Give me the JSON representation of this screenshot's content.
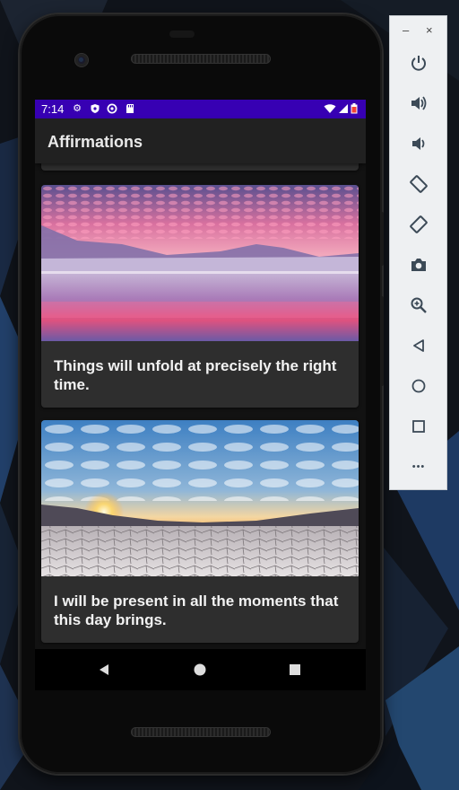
{
  "status_bar": {
    "time": "7:14",
    "icons": [
      "gear-icon",
      "shield-icon",
      "sync-icon",
      "sd-card-icon",
      "wifi-icon",
      "signal-icon",
      "battery-icon"
    ]
  },
  "app": {
    "title": "Affirmations",
    "cards": [
      {
        "text": "Things will unfold at precisely the right time.",
        "image": "pink-sunset-lake"
      },
      {
        "text": "I will be present in all the moments that this day brings.",
        "image": "sunrise-salt-flats"
      }
    ]
  },
  "nav": {
    "buttons": [
      "back-icon",
      "home-icon",
      "recents-icon"
    ]
  },
  "emulator_toolbar": {
    "window_controls": [
      "–",
      "×"
    ],
    "more_label": "•••",
    "buttons": [
      "power-icon",
      "volume-up-icon",
      "volume-down-icon",
      "rotate-left-icon",
      "rotate-right-icon",
      "screenshot-icon",
      "zoom-icon",
      "back-icon",
      "home-icon",
      "overview-icon",
      "more-icon"
    ]
  },
  "colors": {
    "status_bar": "#3700b3",
    "app_bar": "#212121",
    "card": "#2e2e2e"
  }
}
